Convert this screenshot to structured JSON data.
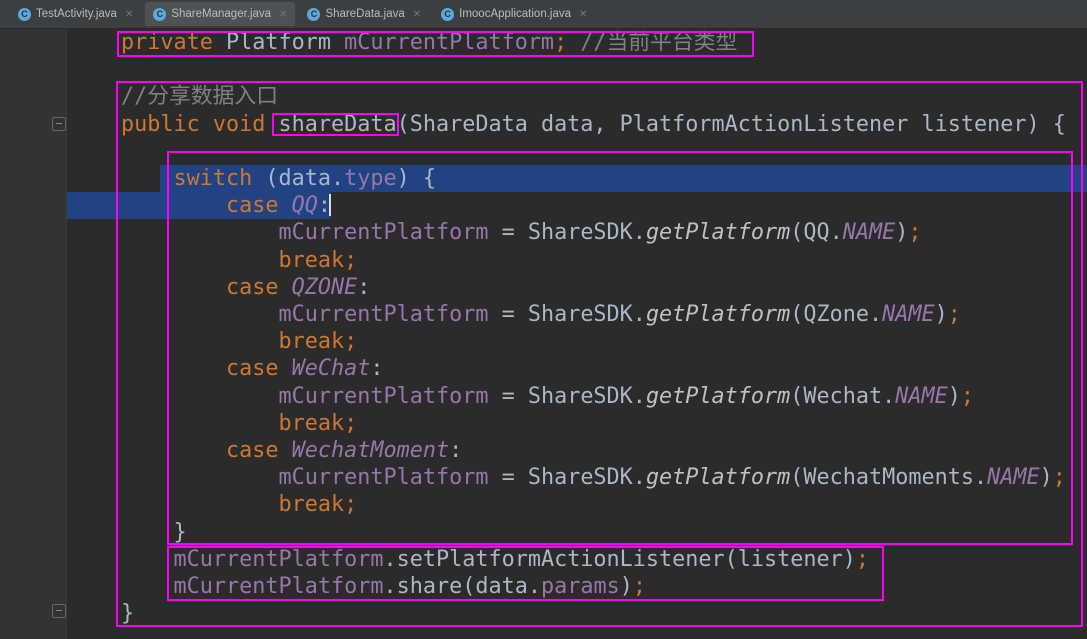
{
  "tabs": [
    {
      "label": "TestActivity.java",
      "icon": "class-icon",
      "active": false
    },
    {
      "label": "ShareManager.java",
      "icon": "class-icon",
      "active": true
    },
    {
      "label": "ShareData.java",
      "icon": "class-icon",
      "active": false
    },
    {
      "label": "ImoocApplication.java",
      "icon": "class-icon",
      "active": false
    }
  ],
  "code": [
    [
      [
        "kw",
        "private "
      ],
      [
        "",
        "Platform "
      ],
      [
        "fld",
        "mCurrentPlatform"
      ],
      [
        "kw",
        "; "
      ],
      [
        "cm",
        "//当前平台类型"
      ]
    ],
    [],
    [
      [
        "cm",
        "//分享数据入口"
      ]
    ],
    [
      [
        "kw",
        "public void "
      ],
      [
        "",
        "shareData(ShareData data, PlatformActionListener listener) {"
      ]
    ],
    [],
    [
      [
        "",
        "    "
      ],
      [
        "kw",
        "switch "
      ],
      [
        "",
        "(data."
      ],
      [
        "fld",
        "type"
      ],
      [
        "",
        ") {"
      ]
    ],
    [
      [
        "",
        "        "
      ],
      [
        "kw",
        "case "
      ],
      [
        "st",
        "QQ"
      ],
      [
        "",
        ":"
      ]
    ],
    [
      [
        "",
        "            "
      ],
      [
        "fld",
        "mCurrentPlatform"
      ],
      [
        "",
        " = ShareSDK."
      ],
      [
        "mi",
        "getPlatform"
      ],
      [
        "",
        "(QQ."
      ],
      [
        "st",
        "NAME"
      ],
      [
        "",
        ")"
      ],
      [
        "kw",
        ";"
      ]
    ],
    [
      [
        "",
        "            "
      ],
      [
        "kw",
        "break;"
      ]
    ],
    [
      [
        "",
        "        "
      ],
      [
        "kw",
        "case "
      ],
      [
        "st",
        "QZONE"
      ],
      [
        "",
        ":"
      ]
    ],
    [
      [
        "",
        "            "
      ],
      [
        "fld",
        "mCurrentPlatform"
      ],
      [
        "",
        " = ShareSDK."
      ],
      [
        "mi",
        "getPlatform"
      ],
      [
        "",
        "(QZone."
      ],
      [
        "st",
        "NAME"
      ],
      [
        "",
        ")"
      ],
      [
        "kw",
        ";"
      ]
    ],
    [
      [
        "",
        "            "
      ],
      [
        "kw",
        "break;"
      ]
    ],
    [
      [
        "",
        "        "
      ],
      [
        "kw",
        "case "
      ],
      [
        "st",
        "WeChat"
      ],
      [
        "",
        ":"
      ]
    ],
    [
      [
        "",
        "            "
      ],
      [
        "fld",
        "mCurrentPlatform"
      ],
      [
        "",
        " = ShareSDK."
      ],
      [
        "mi",
        "getPlatform"
      ],
      [
        "",
        "(Wechat."
      ],
      [
        "st",
        "NAME"
      ],
      [
        "",
        ")"
      ],
      [
        "kw",
        ";"
      ]
    ],
    [
      [
        "",
        "            "
      ],
      [
        "kw",
        "break;"
      ]
    ],
    [
      [
        "",
        "        "
      ],
      [
        "kw",
        "case "
      ],
      [
        "st",
        "WechatMoment"
      ],
      [
        "",
        ":"
      ]
    ],
    [
      [
        "",
        "            "
      ],
      [
        "fld",
        "mCurrentPlatform"
      ],
      [
        "",
        " = ShareSDK."
      ],
      [
        "mi",
        "getPlatform"
      ],
      [
        "",
        "(WechatMoments."
      ],
      [
        "st",
        "NAME"
      ],
      [
        "",
        ")"
      ],
      [
        "kw",
        ";"
      ]
    ],
    [
      [
        "",
        "            "
      ],
      [
        "kw",
        "break;"
      ]
    ],
    [
      [
        "",
        "    }"
      ]
    ],
    [
      [
        "",
        "    "
      ],
      [
        "fld",
        "mCurrentPlatform"
      ],
      [
        "",
        ".setPlatformActionListener(listener)"
      ],
      [
        "kw",
        ";"
      ]
    ],
    [
      [
        "",
        "    "
      ],
      [
        "fld",
        "mCurrentPlatform"
      ],
      [
        "",
        ".share(data."
      ],
      [
        "fld",
        "params"
      ],
      [
        "",
        ")"
      ],
      [
        "kw",
        ";"
      ]
    ],
    [
      [
        "",
        "}"
      ]
    ]
  ]
}
